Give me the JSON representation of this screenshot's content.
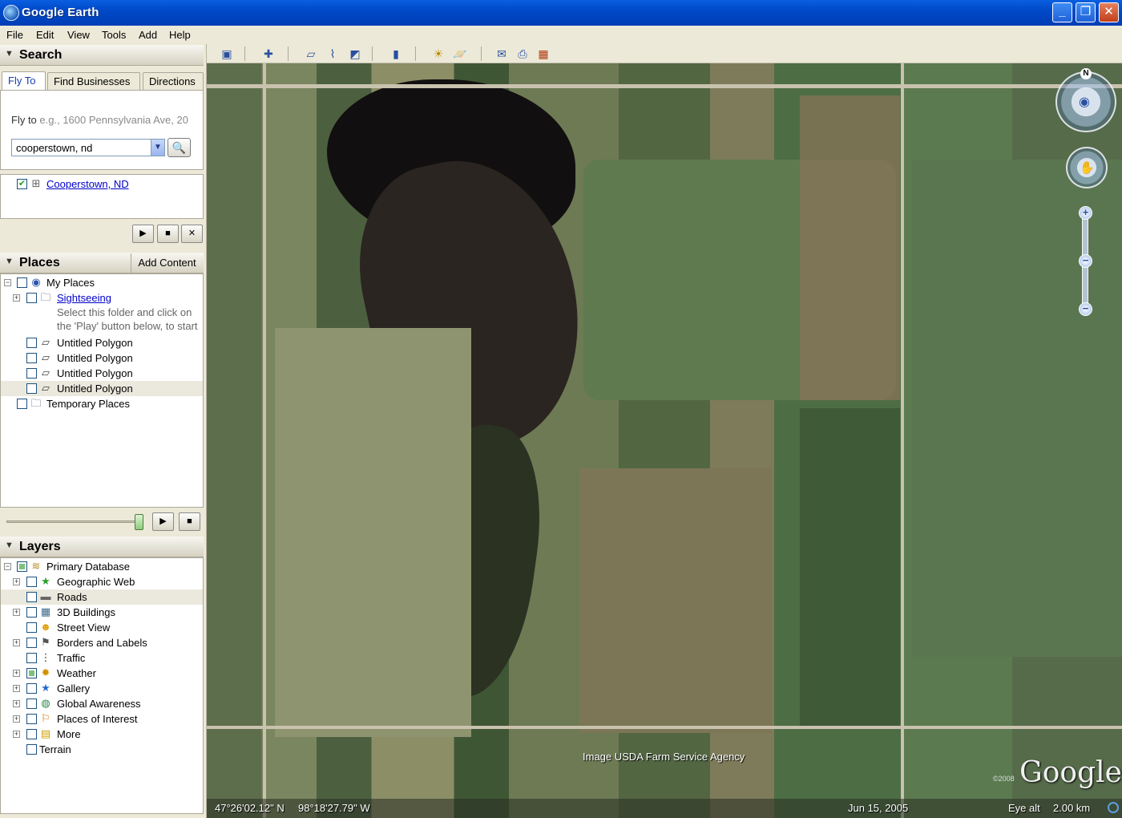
{
  "window": {
    "title": "Google Earth"
  },
  "menu": [
    "File",
    "Edit",
    "View",
    "Tools",
    "Add",
    "Help"
  ],
  "toolbar": {
    "icons": [
      "sidebar-toggle-icon",
      "placemark-icon",
      "polygon-icon",
      "path-icon",
      "image-overlay-icon",
      "ruler-icon",
      "sunlight-icon",
      "planet-icon",
      "email-icon",
      "print-icon",
      "google-maps-icon"
    ]
  },
  "search": {
    "header": "Search",
    "tabs": [
      "Fly To",
      "Find Businesses",
      "Directions"
    ],
    "fly_label": "Fly to",
    "fly_hint": "e.g., 1600 Pennsylvania Ave, 20",
    "query": "cooperstown, nd",
    "result": "Cooperstown, ND"
  },
  "places": {
    "header": "Places",
    "add_content": "Add Content",
    "items": [
      {
        "label": "My Places"
      },
      {
        "label": "Sightseeing"
      },
      {
        "label": "Untitled Polygon"
      },
      {
        "label": "Untitled Polygon"
      },
      {
        "label": "Untitled Polygon"
      },
      {
        "label": "Untitled Polygon"
      },
      {
        "label": "Temporary Places"
      }
    ],
    "description_line1": "Select this folder and click on",
    "description_line2": "the 'Play' button below, to start",
    "tour_slider": 0.97
  },
  "layers": {
    "header": "Layers",
    "items": [
      {
        "label": "Primary Database"
      },
      {
        "label": "Geographic Web"
      },
      {
        "label": "Roads"
      },
      {
        "label": "3D Buildings"
      },
      {
        "label": "Street View"
      },
      {
        "label": "Borders and Labels"
      },
      {
        "label": "Traffic"
      },
      {
        "label": "Weather"
      },
      {
        "label": "Gallery"
      },
      {
        "label": "Global Awareness"
      },
      {
        "label": "Places of Interest"
      },
      {
        "label": "More"
      },
      {
        "label": "Terrain"
      }
    ]
  },
  "map": {
    "attribution": "Image USDA Farm Service Agency",
    "logo": "Google",
    "copyright_year": "©2008",
    "compass_north": "N",
    "status": {
      "lat": "47°26'02.12\" N",
      "lon": "98°18'27.79\" W",
      "date": "Jun 15, 2005",
      "eye_alt_label": "Eye alt",
      "eye_alt_value": "2.00 km"
    }
  },
  "colors": {
    "title_bar": "#0049c8",
    "link": "#0000cc",
    "water": "#120f10"
  }
}
